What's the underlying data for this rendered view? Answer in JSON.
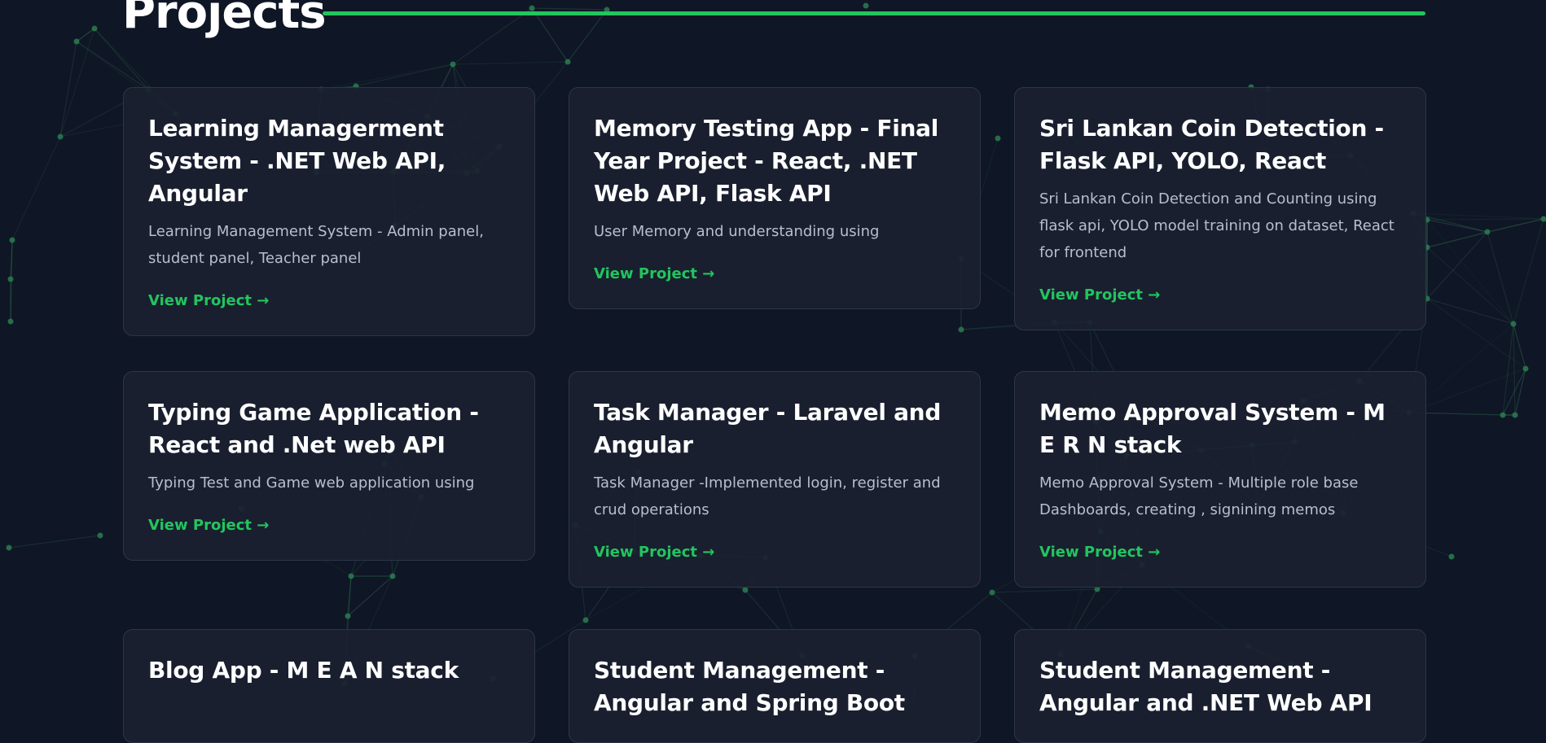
{
  "section": {
    "title": "Projects"
  },
  "colors": {
    "background": "#0f1626",
    "card_background": "#1a2130",
    "card_border": "#2c3648",
    "accent": "#22c55e",
    "title_text": "#ffffff",
    "body_text": "#b7bfcc"
  },
  "projects": [
    {
      "title": "Learning Managerment System - .NET Web API, Angular",
      "description": "Learning Management System - Admin panel, student panel, Teacher panel",
      "link_label": "View Project →"
    },
    {
      "title": "Memory Testing App - Final Year Project - React, .NET Web API, Flask API",
      "description": "User Memory and understanding using",
      "link_label": "View Project →"
    },
    {
      "title": "Sri Lankan Coin Detection - Flask API, YOLO, React",
      "description": "Sri Lankan Coin Detection and Counting using flask api, YOLO model training on dataset, React for frontend",
      "link_label": "View Project →"
    },
    {
      "title": "Typing Game Application - React and .Net web API",
      "description": "Typing Test and Game web application using",
      "link_label": "View Project →"
    },
    {
      "title": "Task Manager - Laravel and Angular",
      "description": "Task Manager -Implemented login, register and crud operations",
      "link_label": "View Project →"
    },
    {
      "title": "Memo Approval System - M E R N stack",
      "description": "Memo Approval System - Multiple role base Dashboards, creating , signining memos",
      "link_label": "View Project →"
    },
    {
      "title": "Blog App - M E A N stack",
      "description": "",
      "link_label": ""
    },
    {
      "title": "Student Management - Angular and Spring Boot",
      "description": "",
      "link_label": ""
    },
    {
      "title": "Student Management - Angular and .NET Web API",
      "description": "",
      "link_label": ""
    }
  ]
}
